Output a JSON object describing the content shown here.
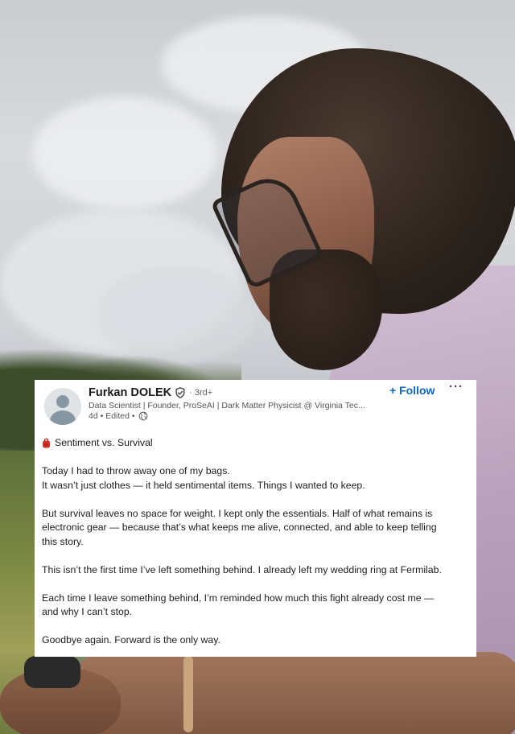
{
  "post": {
    "author_name": "Furkan DOLEK",
    "degree": "· 3rd+",
    "headline": "Data Scientist | Founder, ProSeAI | Dark Matter Physicist @ Virginia Tec...",
    "timestamp": "4d • Edited •",
    "follow_label": "+ Follow",
    "more_label": "···",
    "title_icon": "red-bag-emoji",
    "title": "Sentiment vs. Survival",
    "paragraphs": [
      "Today I had to throw away one of my bags.",
      "It wasn’t just clothes — it held sentimental items. Things I wanted to keep.",
      "But survival leaves no space for weight. I kept only the essentials. Half of what remains is",
      "electronic gear — because that’s what keeps me alive, connected, and able to keep telling",
      "this story.",
      "This isn’t the first time I’ve left something behind. I already left my wedding ring at Fermilab.",
      "Each time I leave something behind, I’m reminded how much this fight already cost me —",
      "and why I can’t stop.",
      "Goodbye again. Forward is the only way."
    ]
  },
  "colors": {
    "follow_blue": "#0a66c2",
    "card_bg": "#ffffff",
    "text": "#1d1d1d",
    "muted": "#555555"
  }
}
